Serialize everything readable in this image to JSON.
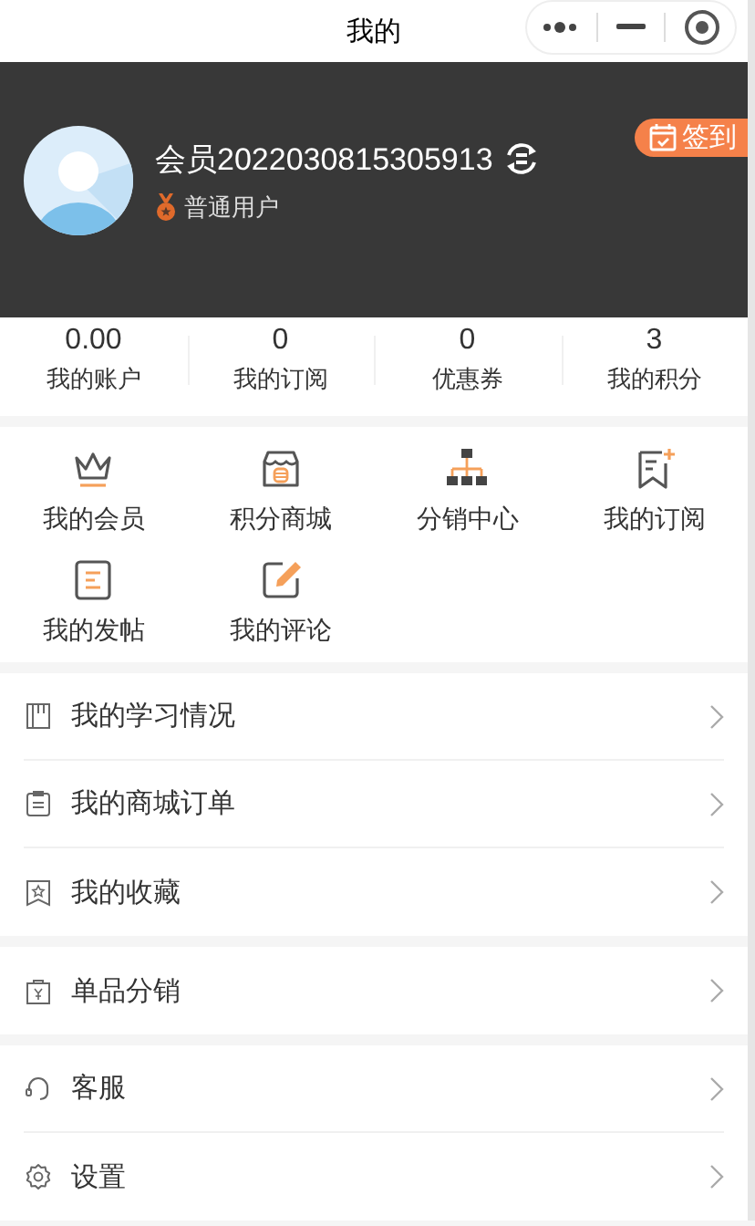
{
  "top_bar": {
    "title": "我的"
  },
  "profile": {
    "name": "会员2022030815305913",
    "level": "普通用户",
    "sign_in": "签到"
  },
  "stats": [
    {
      "value": "0.00",
      "label": "我的账户"
    },
    {
      "value": "0",
      "label": "我的订阅"
    },
    {
      "value": "0",
      "label": "优惠券"
    },
    {
      "value": "3",
      "label": "我的积分"
    }
  ],
  "features": [
    {
      "label": "我的会员"
    },
    {
      "label": "积分商城"
    },
    {
      "label": "分销中心"
    },
    {
      "label": "我的订阅"
    },
    {
      "label": "我的发帖"
    },
    {
      "label": "我的评论"
    }
  ],
  "menu_groups": [
    {
      "items": [
        {
          "label": "我的学习情况"
        },
        {
          "label": "我的商城订单"
        },
        {
          "label": "我的收藏"
        }
      ]
    },
    {
      "items": [
        {
          "label": "单品分销"
        }
      ]
    },
    {
      "items": [
        {
          "label": "客服"
        },
        {
          "label": "设置"
        }
      ]
    }
  ]
}
